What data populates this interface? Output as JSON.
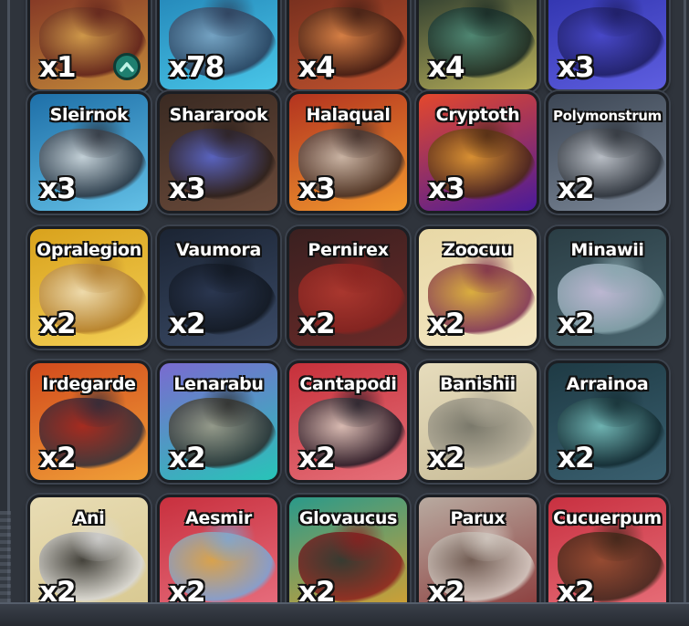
{
  "cards": [
    {
      "name": "",
      "count": "x1",
      "bg": "#7a2a22",
      "bg2": "#c48a3a",
      "c1": "#5b1e1a",
      "c2": "#d6a24e",
      "upgrade": true
    },
    {
      "name": "",
      "count": "x78",
      "bg": "#1f7fb3",
      "bg2": "#49c6e8",
      "c1": "#2a3a55",
      "c2": "#7fa2c0"
    },
    {
      "name": "",
      "count": "x4",
      "bg": "#6b2a1c",
      "bg2": "#c0522e",
      "c1": "#3a1a12",
      "c2": "#e08a4a"
    },
    {
      "name": "",
      "count": "x4",
      "bg": "#1d2e2a",
      "bg2": "#b8b05a",
      "c1": "#152521",
      "c2": "#4a8a7a"
    },
    {
      "name": "",
      "count": "x3",
      "bg": "#2b2fa8",
      "bg2": "#5e5ee0",
      "c1": "#1c1c5e",
      "c2": "#4848c8"
    },
    {
      "name": "Sleirnok",
      "count": "x3",
      "bg": "#1e6fa8",
      "bg2": "#63c0e6",
      "c1": "#2b2f38",
      "c2": "#d9d9d9"
    },
    {
      "name": "Shararook",
      "count": "x3",
      "bg": "#3a2a22",
      "bg2": "#6a4a3a",
      "c1": "#2a1e1a",
      "c2": "#5a6ad8"
    },
    {
      "name": "Halaqual",
      "count": "x3",
      "bg": "#b3331f",
      "bg2": "#f2992e",
      "c1": "#3a2a26",
      "c2": "#c7c0b8"
    },
    {
      "name": "Cryptoth",
      "count": "x3",
      "bg": "#e4482c",
      "bg2": "#4a1a9a",
      "c1": "#4a2812",
      "c2": "#e3a02a"
    },
    {
      "name": "Polymonstrum",
      "count": "x2",
      "bg": "#3c4654",
      "bg2": "#7a8696",
      "c1": "#2a2f36",
      "c2": "#c8ccd2"
    },
    {
      "name": "Opralegion",
      "count": "x2",
      "bg": "#d9a21c",
      "bg2": "#f3cf55",
      "c1": "#b07a2a",
      "c2": "#efe0bf"
    },
    {
      "name": "Vaumora",
      "count": "x2",
      "bg": "#1b2433",
      "bg2": "#3a4a66",
      "c1": "#10161f",
      "c2": "#2a3650"
    },
    {
      "name": "Pernirex",
      "count": "x2",
      "bg": "#3a2020",
      "bg2": "#6a2a28",
      "c1": "#8a2420",
      "c2": "#b83a30"
    },
    {
      "name": "Zoocuu",
      "count": "x2",
      "bg": "#e8d8a6",
      "bg2": "#f3e6c2",
      "c1": "#7a2a4a",
      "c2": "#d6a42a"
    },
    {
      "name": "Minawii",
      "count": "x2",
      "bg": "#2a3d44",
      "bg2": "#4a6670",
      "c1": "#8aa8b0",
      "c2": "#d2c8e6"
    },
    {
      "name": "Irdegarde",
      "count": "x2",
      "bg": "#d24a1c",
      "bg2": "#f0a038",
      "c1": "#2a2a3a",
      "c2": "#9a1e1e"
    },
    {
      "name": "Lenarabu",
      "count": "x2",
      "bg": "#7a6ad0",
      "bg2": "#28c4b8",
      "c1": "#2a2a28",
      "c2": "#a09a80"
    },
    {
      "name": "Cantapodi",
      "count": "x2",
      "bg": "#c6303a",
      "bg2": "#e6707a",
      "c1": "#1c1a24",
      "c2": "#d8ccc0"
    },
    {
      "name": "Banishii",
      "count": "x2",
      "bg": "#e6dcbc",
      "bg2": "#c8bc98",
      "c1": "#b0aa98",
      "c2": "#6a6a60"
    },
    {
      "name": "Arrainoa",
      "count": "x2",
      "bg": "#1e3a44",
      "bg2": "#3a6070",
      "c1": "#122a30",
      "c2": "#7ac4c0"
    },
    {
      "name": "Ani",
      "count": "x2",
      "bg": "#e8dcb4",
      "bg2": "#d8c890",
      "c1": "#d8d8d8",
      "c2": "#2a2a2a"
    },
    {
      "name": "Aesmir",
      "count": "x2",
      "bg": "#c8303e",
      "bg2": "#e87080",
      "c1": "#7aa8d8",
      "c2": "#d8b04a"
    },
    {
      "name": "Glovaucus",
      "count": "x2",
      "bg": "#2a9a8a",
      "bg2": "#d8a030",
      "c1": "#8a1e1e",
      "c2": "#2a2a2a"
    },
    {
      "name": "Parux",
      "count": "x2",
      "bg": "#b8aaa0",
      "bg2": "#8a3a3a",
      "c1": "#d8d0c8",
      "c2": "#6a5a50"
    },
    {
      "name": "Cucuerpum",
      "count": "x2",
      "bg": "#c83040",
      "bg2": "#e8707a",
      "c1": "#3a2418",
      "c2": "#8a4a2a"
    }
  ]
}
